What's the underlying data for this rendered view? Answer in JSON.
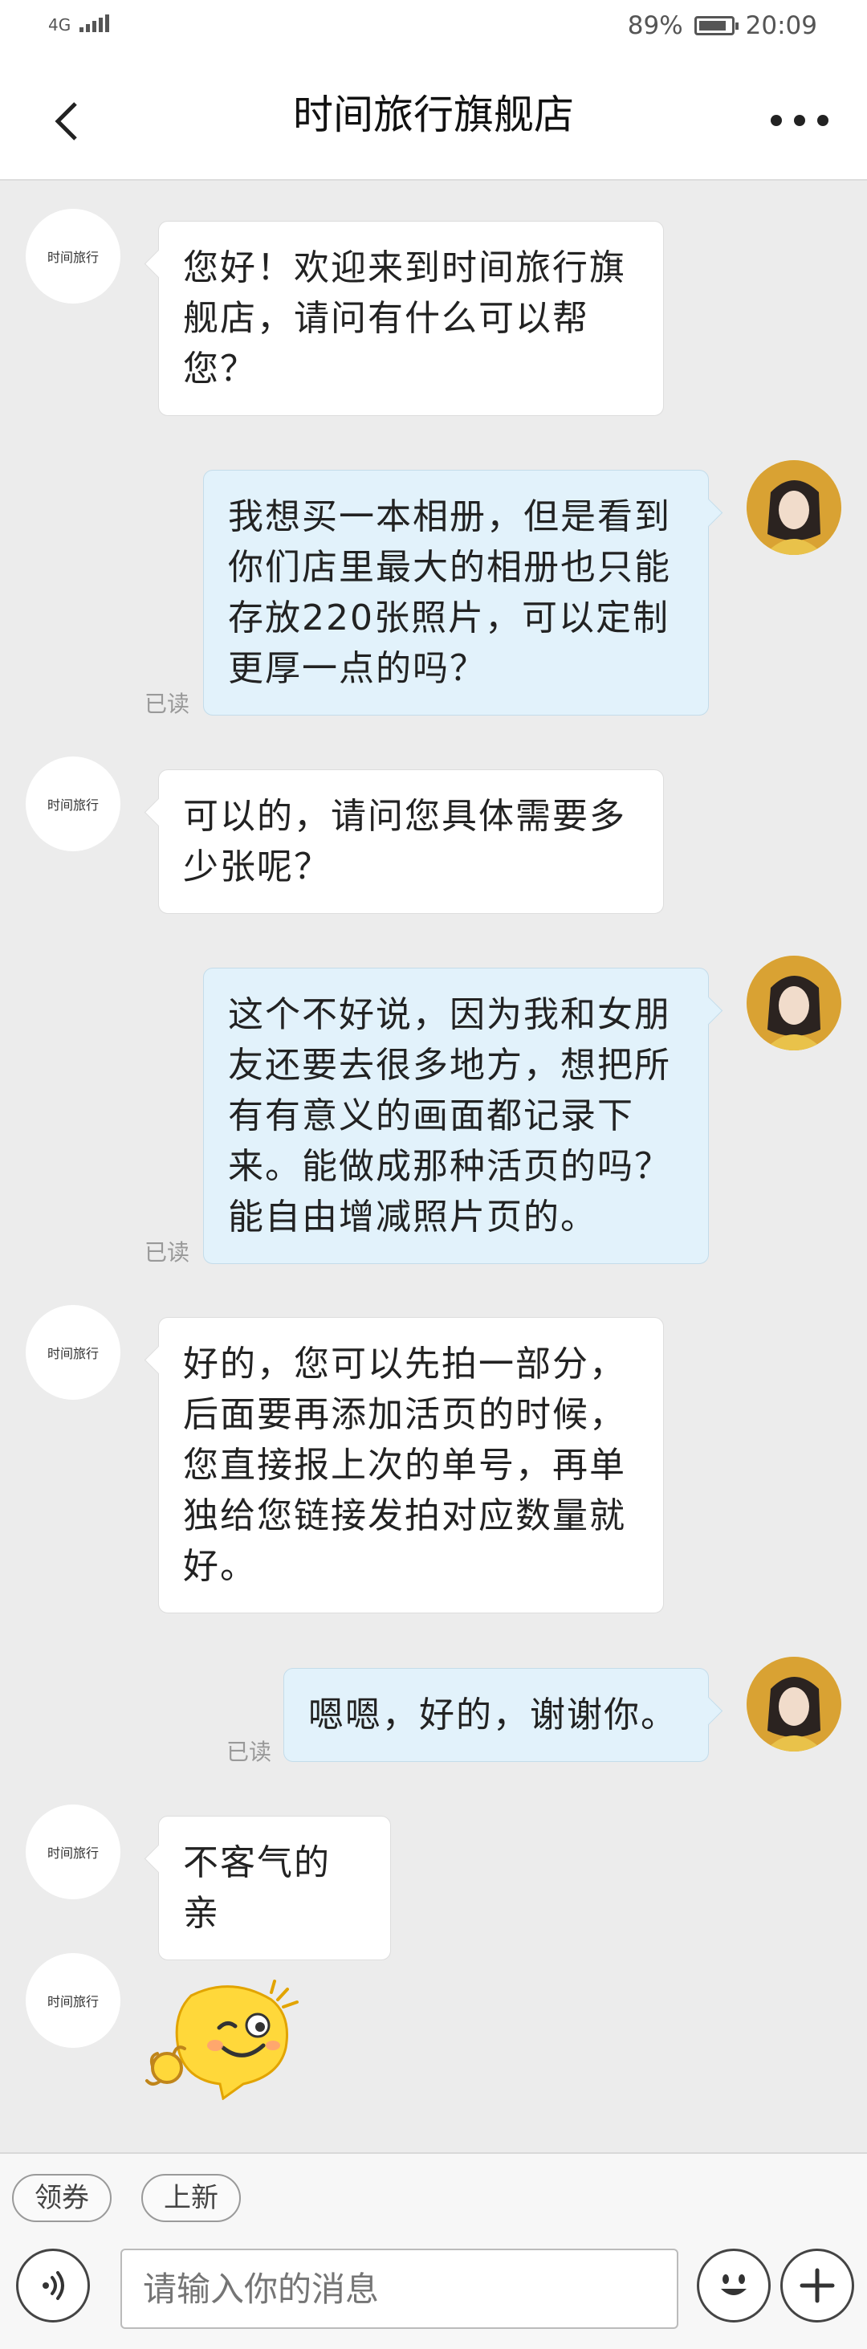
{
  "status_bar": {
    "network": "4G",
    "battery": "89%",
    "battery_level": 0.89,
    "time": "20:09"
  },
  "header": {
    "title": "时间旅行旗舰店"
  },
  "shop_avatar_label": "时间旅行",
  "read_label": "已读",
  "messages": [
    {
      "from": "shop",
      "text": "您好！欢迎来到时间旅行旗舰店，请问有什么可以帮您？"
    },
    {
      "from": "user",
      "text": "我想买一本相册，但是看到你们店里最大的相册也只能存放220张照片，可以定制更厚一点的吗？",
      "read": true
    },
    {
      "from": "shop",
      "text": "可以的，请问您具体需要多少张呢？"
    },
    {
      "from": "user",
      "text": "这个不好说，因为我和女朋友还要去很多地方，想把所有有意义的画面都记录下来。能做成那种活页的吗？能自由增减照片页的。",
      "read": true
    },
    {
      "from": "shop",
      "text": "好的，您可以先拍一部分，后面要再添加活页的时候，您直接报上次的单号，再单独给您链接发拍对应数量就好。"
    },
    {
      "from": "user",
      "text": "嗯嗯，好的，谢谢你。",
      "read": true
    },
    {
      "from": "shop",
      "text": "不客气的亲"
    },
    {
      "from": "shop",
      "sticker": "ok-wink-emoji-sticker"
    }
  ],
  "quick_actions": [
    "领券",
    "上新"
  ],
  "input": {
    "placeholder": "请输入你的消息"
  },
  "icons": [
    "back-icon",
    "more-icon",
    "voice-icon",
    "emoji-icon",
    "plus-icon"
  ]
}
